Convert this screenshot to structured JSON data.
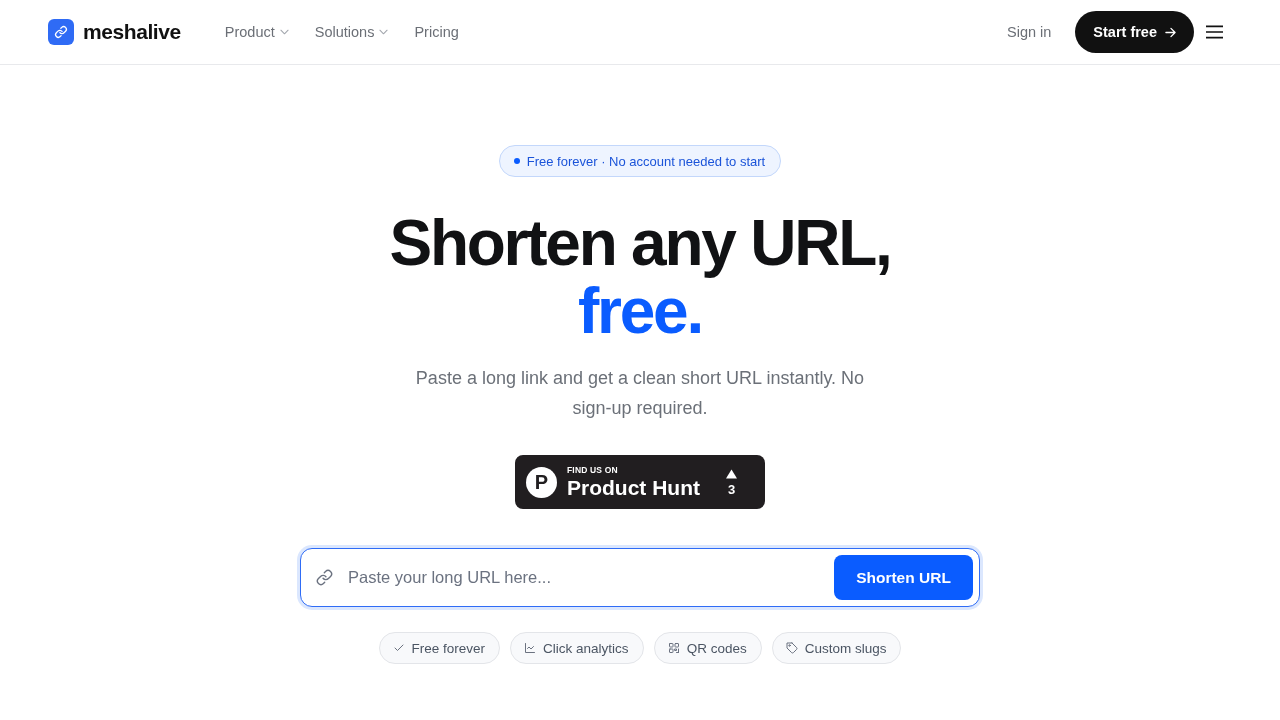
{
  "header": {
    "brand": "meshalive",
    "nav": [
      {
        "label": "Product",
        "kind": "dropdown"
      },
      {
        "label": "Solutions",
        "kind": "dropdown"
      },
      {
        "label": "Pricing",
        "kind": "link"
      }
    ],
    "sign_in": "Sign in",
    "cta": "Start free"
  },
  "hero": {
    "badge": "Free forever · No account needed to start",
    "title": "Shorten any URL,",
    "title_accent": "free.",
    "subtitle": "Paste a long link and get a clean short URL instantly. No sign-up required.",
    "product_hunt": {
      "logo_letter": "P",
      "kicker": "FIND US ON",
      "name": "Product Hunt",
      "votes": "3"
    },
    "shortener": {
      "placeholder": "Paste your long URL here...",
      "button": "Shorten URL"
    },
    "features": [
      {
        "label": "Free forever",
        "kind": "check"
      },
      {
        "label": "Click analytics",
        "kind": "chart"
      },
      {
        "label": "QR codes",
        "kind": "qr"
      },
      {
        "label": "Custom slugs",
        "kind": "tag"
      }
    ]
  }
}
